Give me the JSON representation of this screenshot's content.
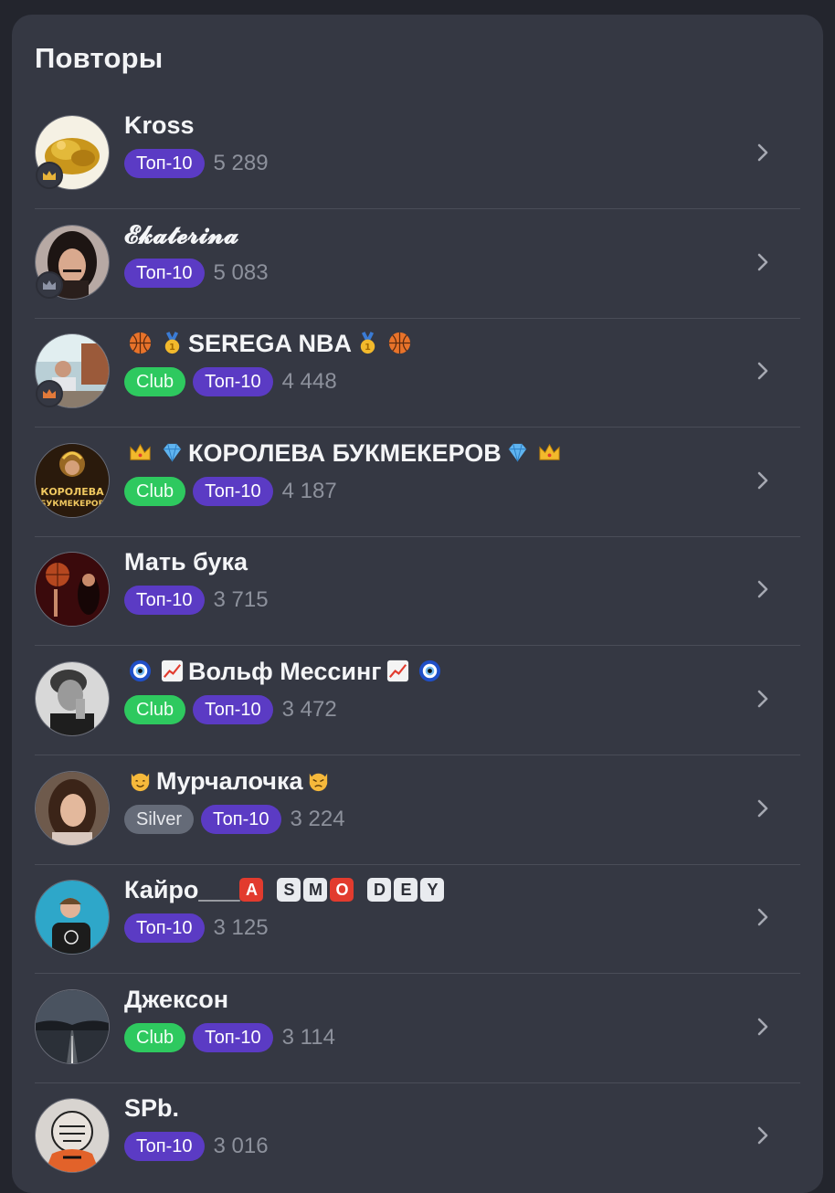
{
  "section_title": "Повторы",
  "colors": {
    "card_bg": "#353843",
    "page_bg": "#23252d",
    "top_badge": "#5b3bc4",
    "club_badge": "#2ec95f",
    "silver_badge": "#656b78"
  },
  "users": [
    {
      "name": "Kross",
      "badges": [
        "Топ-10"
      ],
      "score": "5 289",
      "rank": "gold-crown-icon"
    },
    {
      "name": "𝓔𝓴𝓪𝓽𝓮𝓻𝓲𝓷𝓪",
      "badges": [
        "Топ-10"
      ],
      "score": "5 083",
      "rank": "silver-crown-icon"
    },
    {
      "name_parts": [
        "basketball-icon",
        "gold-medal-icon",
        "SEREGA NBA",
        "gold-medal-icon",
        "basketball-icon"
      ],
      "badges": [
        "Club",
        "Топ-10"
      ],
      "score": "4 448",
      "rank": "bronze-crown-icon"
    },
    {
      "name_parts": [
        "crown-icon",
        "diamond-icon",
        "КОРОЛЕВА БУКМЕКЕРОВ",
        "diamond-icon",
        "crown-icon"
      ],
      "badges": [
        "Club",
        "Топ-10"
      ],
      "score": "4 187",
      "avatar_text": [
        "КОРОЛЕВА",
        "БУКМЕКЕРОВ"
      ]
    },
    {
      "name": "Мать бука",
      "badges": [
        "Топ-10"
      ],
      "score": "3 715"
    },
    {
      "name_parts": [
        "nazar-amulet-icon",
        "chart-up-icon",
        "Вольф Мессинг",
        "chart-up-icon",
        "nazar-amulet-icon"
      ],
      "badges": [
        "Club",
        "Топ-10"
      ],
      "score": "3 472"
    },
    {
      "name_parts": [
        "smiling-cat-icon",
        "Мурчалочка",
        "pouting-cat-icon"
      ],
      "badges": [
        "Silver",
        "Топ-10"
      ],
      "score": "3 224"
    },
    {
      "name_parts": [
        "Кайро___",
        "A",
        "S",
        "M",
        "O",
        "D",
        "E",
        "Y"
      ],
      "badges": [
        "Топ-10"
      ],
      "score": "3 125"
    },
    {
      "name": "Джексон",
      "badges": [
        "Club",
        "Топ-10"
      ],
      "score": "3 114"
    },
    {
      "name": "SPb.",
      "badges": [
        "Топ-10"
      ],
      "score": "3 016"
    }
  ],
  "u": {
    "n0": "Kross",
    "s0": "5 289",
    "n1": "𝓔𝓴𝓪𝓽𝓮𝓻𝓲𝓷𝓪",
    "s1": "5 083",
    "n2": "SEREGA NBA",
    "s2": "4 448",
    "n3": "КОРОЛЕВА БУКМЕКЕРОВ",
    "s3": "4 187",
    "a3a": "КОРОЛЕВА",
    "a3b": "БУКМЕКЕРОВ",
    "n4": "Мать бука",
    "s4": "3 715",
    "n5": "Вольф Мессинг",
    "s5": "3 472",
    "n6": "Мурчалочка",
    "s6": "3 224",
    "n7": "Кайро___",
    "s7": "3 125",
    "n7b": [
      "A",
      "S",
      "M",
      "O",
      "D",
      "E",
      "Y"
    ],
    "n8": "Джексон",
    "s8": "3 114",
    "n9": "SPb.",
    "s9": "3 016",
    "top": "Топ-10",
    "club": "Club",
    "silver": "Silver"
  }
}
